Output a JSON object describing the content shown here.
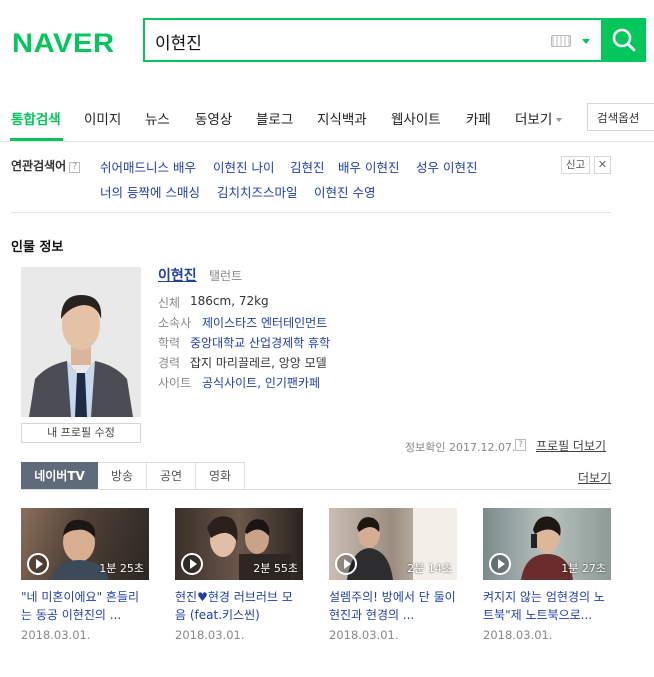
{
  "header": {
    "logo": "NAVER",
    "query": "이현진"
  },
  "tabs": [
    "통합검색",
    "이미지",
    "뉴스",
    "동영상",
    "블로그",
    "지식백과",
    "웹사이트",
    "카페",
    "더보기"
  ],
  "search_options": "검색옵션",
  "related": {
    "label": "연관검색어",
    "help": "?",
    "items": [
      "쉬어매드니스 배우",
      "이현진 나이",
      "김현진",
      "배우 이현진",
      "성우 이현진",
      "너의 등짝에 스매싱",
      "김치치즈스마일",
      "이현진 수영"
    ],
    "report": "신고",
    "close": "✕"
  },
  "person": {
    "section_title": "인물 정보",
    "name": "이현진",
    "job": "탤런트",
    "photo_edit": "내 프로필 수정",
    "rows": [
      {
        "label": "신체",
        "value": "186cm, 72kg"
      },
      {
        "label": "소속사",
        "value": "제이스타즈 엔터테인먼트"
      },
      {
        "label": "학력",
        "value": "중앙대학교 산업경제학 휴학"
      },
      {
        "label": "경력",
        "value": "잡지 마리끌레르, 앙앙 모델"
      },
      {
        "label": "사이트",
        "value": "공식사이트, 인기팬카페"
      }
    ],
    "verified": "정보확인 2017.12.07.",
    "help": "?",
    "profile_more": "프로필 더보기"
  },
  "media": {
    "tabs": [
      "네이버TV",
      "방송",
      "공연",
      "영화"
    ],
    "more": "더보기",
    "videos": [
      {
        "title": "\"네 미혼이에요\" 흔들리는 동공 이현진의 ...",
        "duration": "1분 25초",
        "date": "2018.03.01."
      },
      {
        "title": "현진♥현경 러브러브 모음 (feat.키스씬)",
        "duration": "2분 55초",
        "date": "2018.03.01."
      },
      {
        "title": "설렘주의! 방에서 단 둘이 현진과 현경의 ...",
        "duration": "2분 14초",
        "date": "2018.03.01."
      },
      {
        "title": "켜지지 않는 엄현경의 노트북\"제 노트북으로...",
        "duration": "1분 27초",
        "date": "2018.03.01."
      }
    ]
  },
  "colors": {
    "brand": "#03c75a",
    "link": "#1f3fa8",
    "tab_active_bg": "#5f6b7a"
  }
}
